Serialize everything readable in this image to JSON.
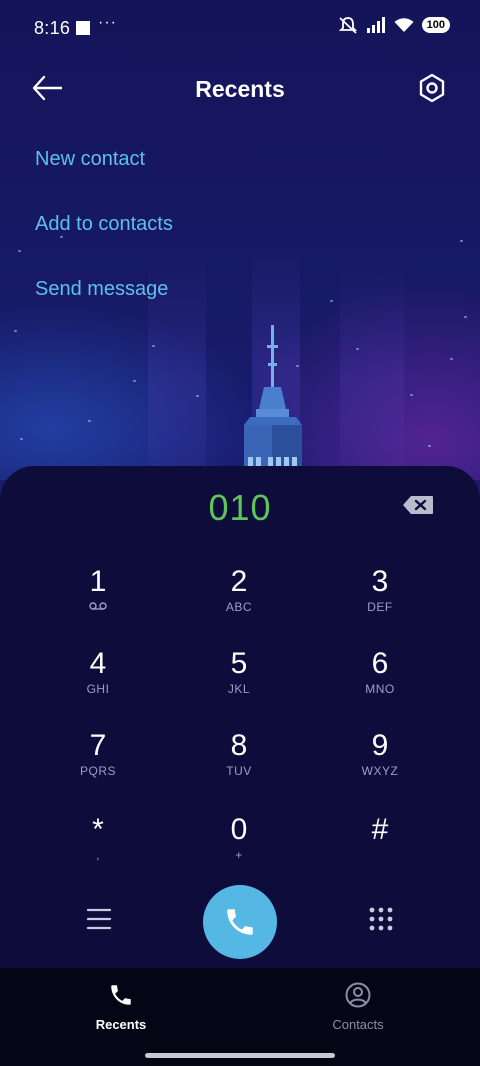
{
  "status_bar": {
    "time": "8:16",
    "more": "···",
    "battery": "100",
    "icons": [
      "mute-icon",
      "signal-icon",
      "wifi-icon",
      "battery-icon"
    ]
  },
  "header": {
    "title": "Recents",
    "back_icon": "back-arrow-icon",
    "settings_icon": "settings-hexagon-icon"
  },
  "actions": [
    {
      "label": "New contact"
    },
    {
      "label": "Add to contacts"
    },
    {
      "label": "Send message"
    }
  ],
  "dialer": {
    "number": "010",
    "number_color": "#5fc45a",
    "keys": [
      {
        "digit": "1",
        "letters": ""
      },
      {
        "digit": "2",
        "letters": "ABC"
      },
      {
        "digit": "3",
        "letters": "DEF"
      },
      {
        "digit": "4",
        "letters": "GHI"
      },
      {
        "digit": "5",
        "letters": "JKL"
      },
      {
        "digit": "6",
        "letters": "MNO"
      },
      {
        "digit": "7",
        "letters": "PQRS"
      },
      {
        "digit": "8",
        "letters": "TUV"
      },
      {
        "digit": "9",
        "letters": "WXYZ"
      },
      {
        "digit": "*",
        "letters": ","
      },
      {
        "digit": "0",
        "letters": "+"
      },
      {
        "digit": "#",
        "letters": ""
      }
    ],
    "call_color": "#55b8e4"
  },
  "bottom_nav": {
    "items": [
      {
        "label": "Recents",
        "icon": "phone-icon",
        "active": true
      },
      {
        "label": "Contacts",
        "icon": "contact-person-icon",
        "active": false
      }
    ]
  },
  "colors": {
    "link": "#5ec0ea",
    "panel": "#0d0c3b"
  }
}
